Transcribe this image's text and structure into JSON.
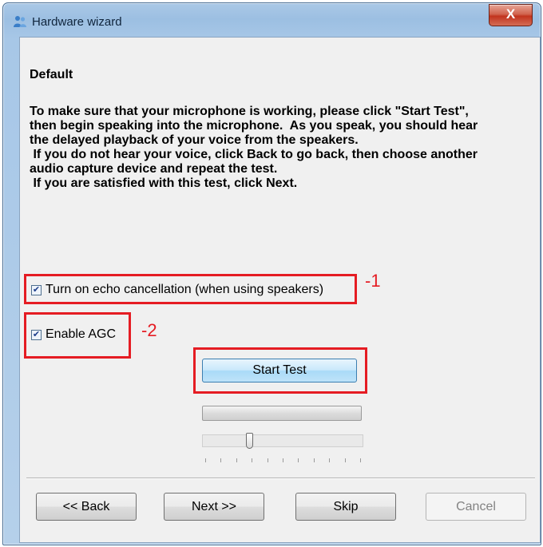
{
  "window": {
    "title": "Hardware wizard",
    "close_glyph": "X"
  },
  "content": {
    "heading": "Default",
    "instructions": "To make sure that your microphone is working, please click \"Start Test\",\nthen begin speaking into the microphone.  As you speak, you should hear\nthe delayed playback of your voice from the speakers.\n If you do not hear your voice, click Back to go back, then choose another\naudio capture device and repeat the test.\n If you are satisfied with this test, click Next."
  },
  "options": {
    "echo_cancellation": {
      "label": "Turn on echo cancellation (when using speakers)",
      "checked": true
    },
    "agc": {
      "label": "Enable AGC",
      "checked": true
    }
  },
  "annotations": {
    "echo": "-1",
    "agc": "-2"
  },
  "test": {
    "start_label": "Start Test",
    "level_fraction": 0.0,
    "volume_fraction": 0.28
  },
  "nav": {
    "back": "<< Back",
    "next": "Next >>",
    "skip": "Skip",
    "cancel": "Cancel"
  },
  "colors": {
    "annotation": "#e51c23",
    "accent": "#3c7fb1"
  },
  "icons": {
    "app": "users-icon",
    "close": "close-icon",
    "check": "checkmark-icon"
  }
}
